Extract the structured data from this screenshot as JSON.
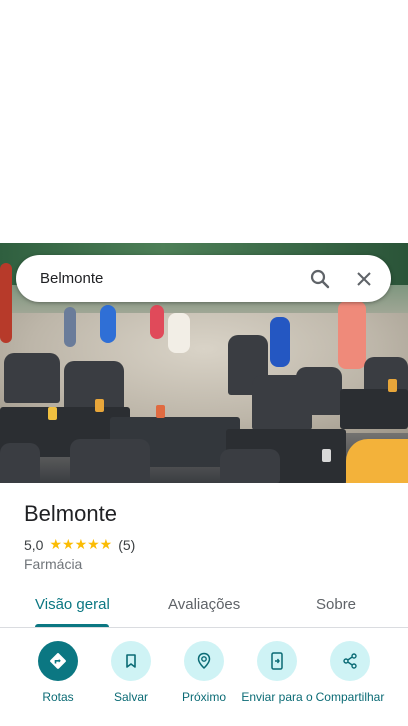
{
  "search": {
    "value": "Belmonte",
    "search_icon": "search-icon",
    "close_icon": "close-icon"
  },
  "place": {
    "name": "Belmonte",
    "rating": "5,0",
    "stars": "★★★★★",
    "reviews_count": "(5)",
    "category": "Farmácia"
  },
  "tabs": [
    {
      "label": "Visão geral",
      "active": true
    },
    {
      "label": "Avaliações",
      "active": false
    },
    {
      "label": "Sobre",
      "active": false
    }
  ],
  "actions": [
    {
      "label": "Rotas",
      "icon": "directions-icon"
    },
    {
      "label": "Salvar",
      "icon": "bookmark-icon"
    },
    {
      "label": "Próximo",
      "icon": "nearby-icon"
    },
    {
      "label": "Enviar para o",
      "icon": "send-to-phone-icon"
    },
    {
      "label": "Compartilhar",
      "icon": "share-icon"
    }
  ],
  "colors": {
    "accent": "#0b7782",
    "accent_light": "#cff3f5",
    "star": "#fbbc04"
  }
}
